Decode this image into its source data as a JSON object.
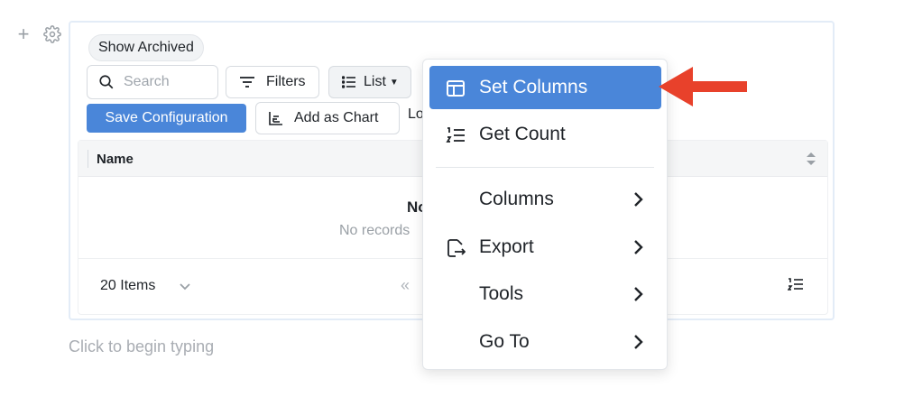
{
  "gutter": {
    "add_icon": "plus-icon",
    "settings_icon": "gear-icon"
  },
  "toolbar": {
    "show_archived": "Show Archived",
    "search_placeholder": "Search",
    "search_value": "",
    "filters": "Filters",
    "list": "List",
    "save_configuration": "Save Configuration",
    "add_as_chart": "Add as Chart",
    "truncated_text": "Lo"
  },
  "table": {
    "columns": [
      {
        "label": "Name"
      }
    ],
    "empty_title": "No",
    "empty_subtitle": "No records",
    "footer": {
      "items_count": "20 Items"
    }
  },
  "menu": {
    "items": [
      {
        "label": "Set Columns",
        "icon": "columns-layout-icon",
        "active": true,
        "submenu": false
      },
      {
        "label": "Get Count",
        "icon": "numbered-list-icon",
        "active": false,
        "submenu": false
      },
      {
        "label": "Columns",
        "icon": "",
        "active": false,
        "submenu": true
      },
      {
        "label": "Export",
        "icon": "export-icon",
        "active": false,
        "submenu": true
      },
      {
        "label": "Tools",
        "icon": "",
        "active": false,
        "submenu": true
      },
      {
        "label": "Go To",
        "icon": "",
        "active": false,
        "submenu": true
      }
    ]
  },
  "editor": {
    "placeholder": "Click to begin typing"
  },
  "colors": {
    "accent": "#4a86d9",
    "arrow": "#e8412b",
    "block_border": "#e3ecf7"
  }
}
